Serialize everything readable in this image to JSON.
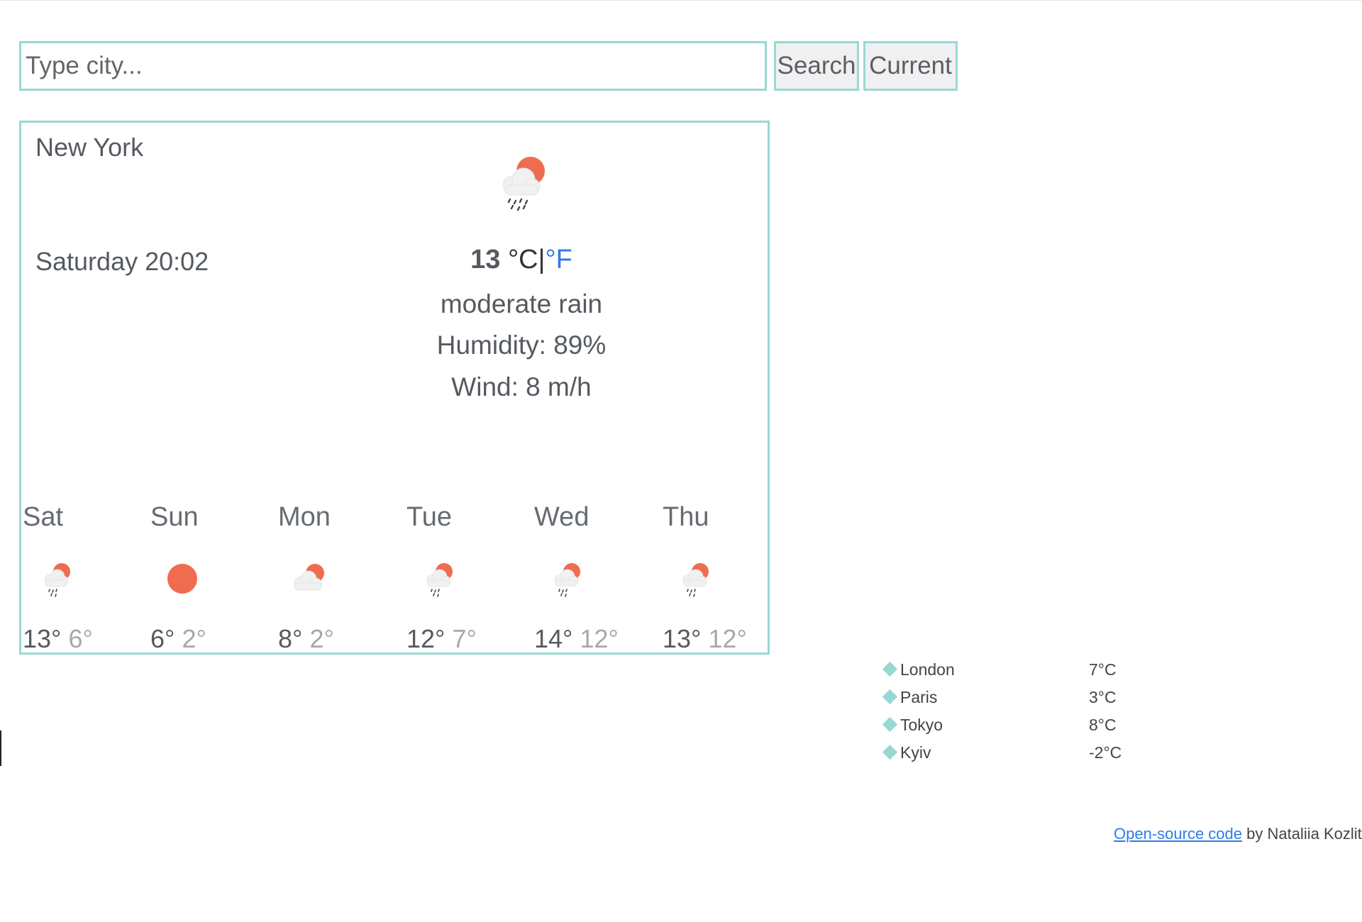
{
  "search": {
    "placeholder": "Type city...",
    "search_label": "Search",
    "current_label": "Current"
  },
  "weather": {
    "city": "New York",
    "datetime": "Saturday 20:02",
    "temperature": "13",
    "unit_c": "°C",
    "unit_sep": "|",
    "unit_f": "°F",
    "description": "moderate rain",
    "humidity": "Humidity: 89%",
    "wind": "Wind: 8 m/h",
    "icon": "rain-cloud-sun-icon"
  },
  "forecast": [
    {
      "day": "Sat",
      "max": "13°",
      "min": "6°",
      "icon": "rain-cloud-sun-icon"
    },
    {
      "day": "Sun",
      "max": "6°",
      "min": "2°",
      "icon": "sun-icon"
    },
    {
      "day": "Mon",
      "max": "8°",
      "min": "2°",
      "icon": "cloud-sun-icon"
    },
    {
      "day": "Tue",
      "max": "12°",
      "min": "7°",
      "icon": "rain-cloud-sun-icon"
    },
    {
      "day": "Wed",
      "max": "14°",
      "min": "12°",
      "icon": "rain-cloud-sun-icon"
    },
    {
      "day": "Thu",
      "max": "13°",
      "min": "12°",
      "icon": "rain-cloud-sun-icon"
    }
  ],
  "cities": [
    {
      "name": "London",
      "temp": "7°C"
    },
    {
      "name": "Paris",
      "temp": "3°C"
    },
    {
      "name": "Tokyo",
      "temp": "8°C"
    },
    {
      "name": "Kyiv",
      "temp": "-2°C"
    }
  ],
  "footer": {
    "link_text": "Open-source code",
    "suffix": " by Nataliia Kozlitina"
  },
  "colors": {
    "accent_border": "#98d8d3",
    "sun": "#ef6c4e",
    "link": "#2f7ce6"
  }
}
